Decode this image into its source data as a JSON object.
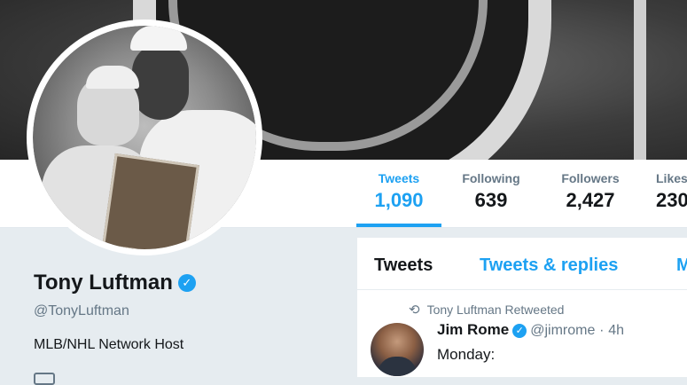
{
  "banner": {
    "image": "nhl-shield-banner"
  },
  "avatar": {
    "image": "profile-photo"
  },
  "nav": {
    "items": [
      {
        "label": "Tweets",
        "value": "1,090",
        "active": true
      },
      {
        "label": "Following",
        "value": "639",
        "active": false
      },
      {
        "label": "Followers",
        "value": "2,427",
        "active": false
      },
      {
        "label": "Likes",
        "value": "230",
        "active": false
      }
    ]
  },
  "profile": {
    "name": "Tony Luftman",
    "verified_icon": "verified-check-icon",
    "handle": "@TonyLuftman",
    "bio": "MLB/NHL Network Host"
  },
  "timeline": {
    "tabs": [
      {
        "label": "Tweets",
        "active": true
      },
      {
        "label": "Tweets & replies",
        "active": false
      },
      {
        "label": "M",
        "active": false
      }
    ],
    "retweet_icon": "retweet-icon",
    "retweet_text": "Tony Luftman Retweeted",
    "tweet": {
      "author_name": "Jim Rome",
      "author_handle": "@jimrome",
      "separator": "·",
      "time": "4h",
      "text": "Monday:"
    }
  },
  "colors": {
    "accent": "#1da1f2",
    "text": "#14171a",
    "muted": "#657786",
    "background": "#e6ecf0"
  }
}
